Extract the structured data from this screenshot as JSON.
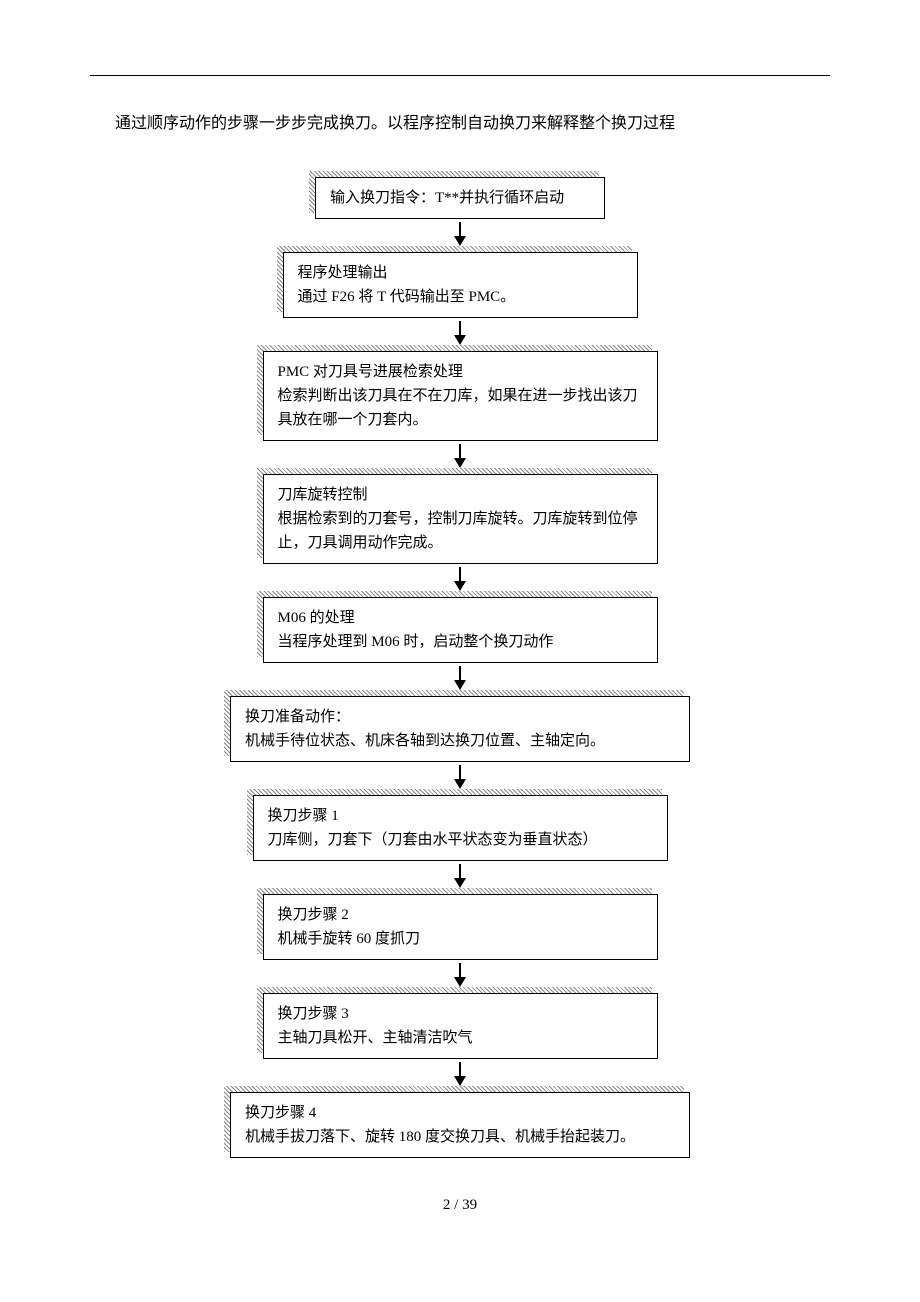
{
  "intro": "通过顺序动作的步骤一步步完成换刀。以程序控制自动换刀来解释整个换刀过程",
  "steps": [
    {
      "text": "输入换刀指令：T**并执行循环启动"
    },
    {
      "title": "程序处理输出",
      "body": "通过 F26 将 T 代码输出至 PMC。"
    },
    {
      "title": "PMC 对刀具号进展检索处理",
      "body": "检索判断出该刀具在不在刀库，如果在进一步找出该刀具放在哪一个刀套内。"
    },
    {
      "title": "刀库旋转控制",
      "body": "根据检索到的刀套号，控制刀库旋转。刀库旋转到位停止，刀具调用动作完成。"
    },
    {
      "title": "M06 的处理",
      "body": "当程序处理到 M06 时，启动整个换刀动作"
    },
    {
      "title": "换刀准备动作：",
      "body": "机械手待位状态、机床各轴到达换刀位置、主轴定向。"
    },
    {
      "title": "换刀步骤 1",
      "body": "刀库侧，刀套下（刀套由水平状态变为垂直状态）"
    },
    {
      "title": "换刀步骤 2",
      "body": "机械手旋转 60 度抓刀"
    },
    {
      "title": "换刀步骤 3",
      "body": "主轴刀具松开、主轴清洁吹气"
    },
    {
      "title": "换刀步骤 4",
      "body": "机械手拔刀落下、旋转 180 度交换刀具、机械手抬起装刀。"
    }
  ],
  "footer": "2  / 39"
}
